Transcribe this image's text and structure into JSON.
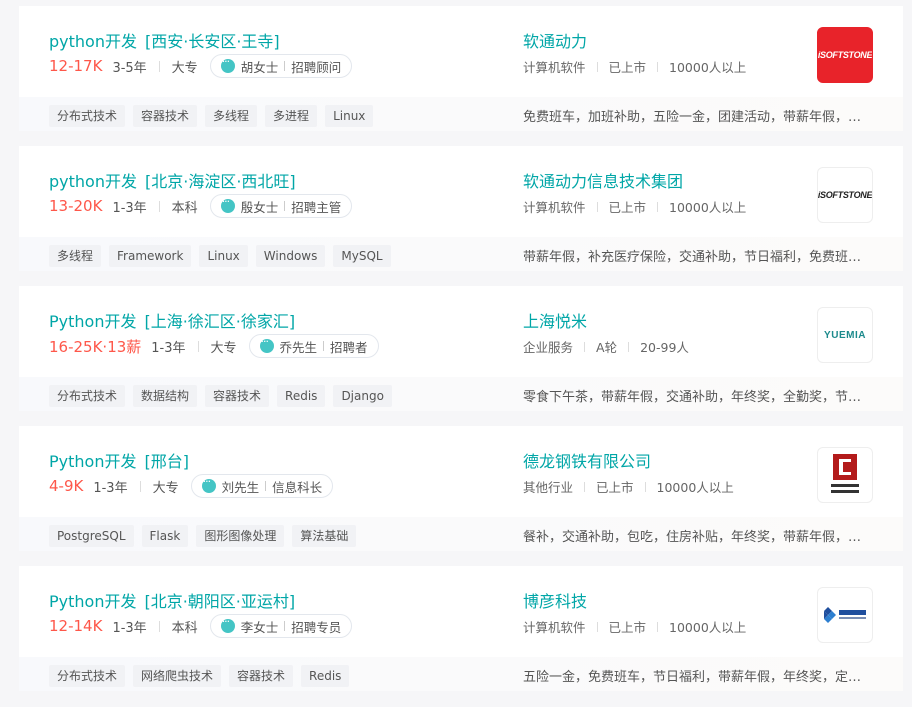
{
  "jobs": [
    {
      "title": "python开发",
      "area": "[西安·长安区·王寺]",
      "salary": "12-17K",
      "experience": "3-5年",
      "degree": "大专",
      "recruiter_name": "胡女士",
      "recruiter_title": "招聘顾问",
      "company": "软通动力",
      "industry": "计算机软件",
      "stage": "已上市",
      "size": "10000人以上",
      "logo_icon": "isoftstone-red-logo",
      "tags": [
        "分布式技术",
        "容器技术",
        "多线程",
        "多进程",
        "Linux"
      ],
      "welfare": "免费班车，加班补助，五险一金，团建活动，带薪年假，补充医疗保险"
    },
    {
      "title": "python开发",
      "area": "[北京·海淀区·西北旺]",
      "salary": "13-20K",
      "experience": "1-3年",
      "degree": "本科",
      "recruiter_name": "殷女士",
      "recruiter_title": "招聘主管",
      "company": "软通动力信息技术集团",
      "industry": "计算机软件",
      "stage": "已上市",
      "size": "10000人以上",
      "logo_icon": "isoftstone-white-logo",
      "tags": [
        "多线程",
        "Framework",
        "Linux",
        "Windows",
        "MySQL"
      ],
      "welfare": "带薪年假，补充医疗保险，交通补助，节日福利，免费班车，五险一金"
    },
    {
      "title": "Python开发",
      "area": "[上海·徐汇区·徐家汇]",
      "salary": "16-25K·13薪",
      "experience": "1-3年",
      "degree": "大专",
      "recruiter_name": "乔先生",
      "recruiter_title": "招聘者",
      "company": "上海悦米",
      "industry": "企业服务",
      "stage": "A轮",
      "size": "20-99人",
      "logo_icon": "yuemia-logo",
      "tags": [
        "分布式技术",
        "数据结构",
        "容器技术",
        "Redis",
        "Django"
      ],
      "welfare": "零食下午茶，带薪年假，交通补助，年终奖，全勤奖，节日福利"
    },
    {
      "title": "Python开发",
      "area": "[邢台]",
      "salary": "4-9K",
      "experience": "1-3年",
      "degree": "大专",
      "recruiter_name": "刘先生",
      "recruiter_title": "信息科长",
      "company": "德龙钢铁有限公司",
      "industry": "其他行业",
      "stage": "已上市",
      "size": "10000人以上",
      "logo_icon": "delong-logo",
      "tags": [
        "PostgreSQL",
        "Flask",
        "图形图像处理",
        "算法基础"
      ],
      "welfare": "餐补，交通补助，包吃，住房补贴，年终奖，带薪年假，五险一金"
    },
    {
      "title": "Python开发",
      "area": "[北京·朝阳区·亚运村]",
      "salary": "12-14K",
      "experience": "1-3年",
      "degree": "本科",
      "recruiter_name": "李女士",
      "recruiter_title": "招聘专员",
      "company": "博彦科技",
      "industry": "计算机软件",
      "stage": "已上市",
      "size": "10000人以上",
      "logo_icon": "beyondsoft-logo",
      "tags": [
        "分布式技术",
        "网络爬虫技术",
        "容器技术",
        "Redis"
      ],
      "welfare": "五险一金，免费班车，节日福利，带薪年假，年终奖，定期体检"
    }
  ],
  "logo_text": {
    "isoftstone": "iSOFTSTONE",
    "yuemia": "YUEMIA"
  },
  "colors": {
    "accent": "#00a6a7",
    "salary": "#fe574a",
    "isoftstone_red": "#e8232a"
  }
}
